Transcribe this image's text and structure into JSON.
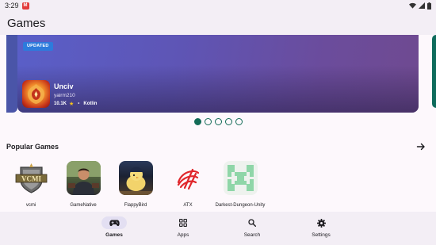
{
  "status_bar": {
    "time": "3:29",
    "notif": "M"
  },
  "topbar": {
    "title": "Games"
  },
  "featured": {
    "badge": "UPDATED",
    "name": "Unciv",
    "developer": "yairm210",
    "downloads": "10.1K",
    "star": "★",
    "separator": "•",
    "language": "Kotlin",
    "pager": {
      "count": 5,
      "active": 0
    }
  },
  "popular": {
    "title": "Popular Games",
    "games": [
      {
        "label": "vcmi",
        "icon": "vcmi-logo-icon"
      },
      {
        "label": "GameNative",
        "icon": "gamenative-avatar-icon"
      },
      {
        "label": "FlappyBird",
        "icon": "flappybird-chick-icon"
      },
      {
        "label": "ATX",
        "icon": "atx-logo-icon"
      },
      {
        "label": "Darkest-Dungeon-Unity",
        "icon": "darkest-dungeon-identicon"
      }
    ]
  },
  "nav": {
    "items": [
      {
        "label": "Games",
        "icon": "gamepad-icon",
        "active": true
      },
      {
        "label": "Apps",
        "icon": "apps-grid-icon",
        "active": false
      },
      {
        "label": "Search",
        "icon": "search-icon",
        "active": false
      },
      {
        "label": "Settings",
        "icon": "gear-icon",
        "active": false
      }
    ]
  },
  "colors": {
    "accent": "#136b57",
    "badge": "#2d7bdc",
    "star": "#f7c21b"
  }
}
